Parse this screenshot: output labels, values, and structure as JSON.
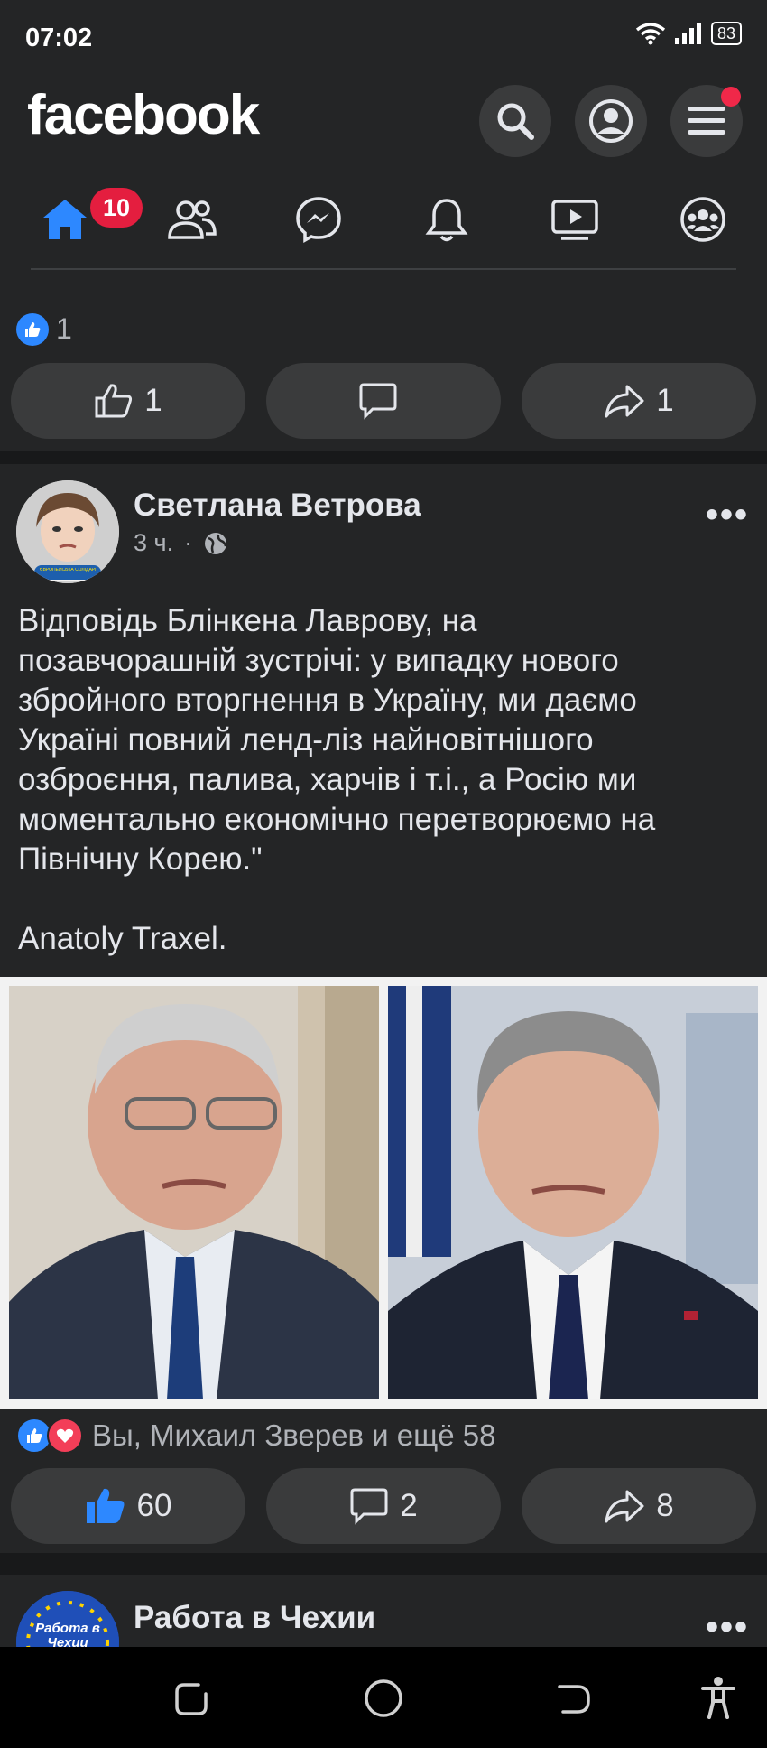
{
  "status_bar": {
    "time": "07:02",
    "battery": "83"
  },
  "header": {
    "logo": "facebook",
    "search_icon": "search-icon",
    "profile_icon": "profile-icon",
    "menu_icon": "menu-icon",
    "notification_dot": true
  },
  "tabs": [
    {
      "name": "home",
      "icon": "home-icon",
      "badge": "10",
      "active": true
    },
    {
      "name": "friends",
      "icon": "friends-icon"
    },
    {
      "name": "messenger",
      "icon": "messenger-icon"
    },
    {
      "name": "notifications",
      "icon": "bell-icon"
    },
    {
      "name": "watch",
      "icon": "video-icon"
    },
    {
      "name": "groups",
      "icon": "groups-icon"
    }
  ],
  "prev_post": {
    "reaction_count": "1",
    "like_label": "1",
    "comment_label": "",
    "share_label": "1"
  },
  "post": {
    "author": "Светлана Ветрова",
    "time": "3 ч.",
    "privacy_icon": "globe-icon",
    "text": "Відповідь Блінкена Лаврову, на\nпозавчорашній зустрічі: у випадку нового\nзбройного вторгнення в Україну, ми даємо\nУкраїні повний ленд-ліз найновітнішого\nозброєння, палива, харчів і т.і., а Росію ми\nмоментально економічно перетворюємо на\nПівнічну Корею.\"\n\nAnatoly Traxel.",
    "avatar_label": "ЄВРОПЕЙСЬКА СОЛІДАРНІСТЬ",
    "reactions_summary": "Вы, Михаил Зверев и ещё 58",
    "like_count": "60",
    "comment_count": "2",
    "share_count": "8"
  },
  "next_post": {
    "author": "Работа в Чехии",
    "avatar_label": "Работа в Чехии"
  },
  "colors": {
    "background": "#18191a",
    "surface": "#242526",
    "pill": "#3a3b3c",
    "accent": "#2d88ff",
    "badge": "#e41e3f",
    "love": "#f33e58"
  }
}
